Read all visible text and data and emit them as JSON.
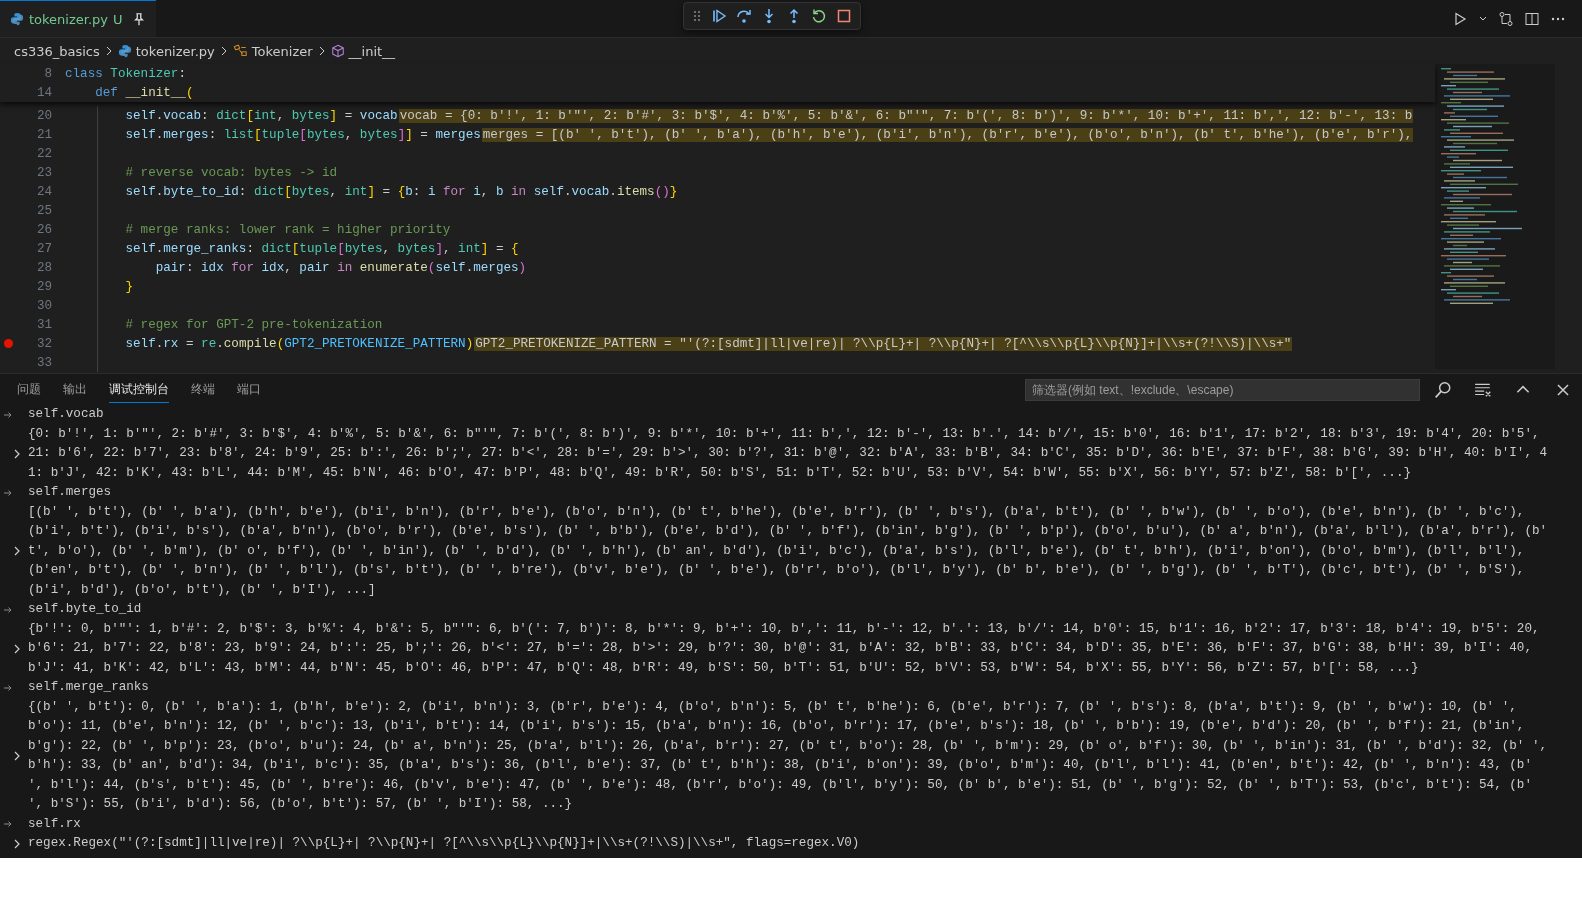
{
  "editor_tab": {
    "label": "tokenizer.py",
    "status": "U",
    "pinned": true
  },
  "breadcrumb": [
    {
      "kind": "folder",
      "label": "cs336_basics"
    },
    {
      "kind": "python",
      "label": "tokenizer.py"
    },
    {
      "kind": "class",
      "label": "Tokenizer"
    },
    {
      "kind": "method",
      "label": "__init__"
    }
  ],
  "sticky_lines": [
    {
      "num": "8",
      "tokens": [
        {
          "kind": "kw",
          "text": "class"
        },
        {
          "kind": "cls",
          "text": " Tokenizer"
        },
        {
          "kind": "op",
          "text": ":"
        }
      ]
    },
    {
      "num": "14",
      "tokens": [
        {
          "kind": "kw",
          "text": "    def"
        },
        {
          "kind": "fn",
          "text": " __init__"
        },
        {
          "kind": "b1",
          "text": "("
        }
      ]
    }
  ],
  "code_lines": [
    {
      "num": "20",
      "breakpoint": false,
      "tokens": [
        {
          "kind": "var",
          "text": "        self"
        },
        {
          "kind": "op",
          "text": "."
        },
        {
          "kind": "var",
          "text": "vocab"
        },
        {
          "kind": "op",
          "text": ": "
        },
        {
          "kind": "cls",
          "text": "dict"
        },
        {
          "kind": "b1",
          "text": "["
        },
        {
          "kind": "cls",
          "text": "int"
        },
        {
          "kind": "op",
          "text": ", "
        },
        {
          "kind": "cls",
          "text": "bytes"
        },
        {
          "kind": "b1",
          "text": "]"
        },
        {
          "kind": "op",
          "text": " = "
        },
        {
          "kind": "var",
          "text": "vocab"
        }
      ],
      "inline_value": "vocab = {0: b'!', 1: b'\"', 2: b'#', 3: b'$', 4: b'%', 5: b'&', 6: b\"'\", 7: b'(', 8: b')', 9: b'*', 10: b'+', 11: b',', 12: b'-', 13: b"
    },
    {
      "num": "21",
      "breakpoint": false,
      "tokens": [
        {
          "kind": "var",
          "text": "        self"
        },
        {
          "kind": "op",
          "text": "."
        },
        {
          "kind": "var",
          "text": "merges"
        },
        {
          "kind": "op",
          "text": ": "
        },
        {
          "kind": "cls",
          "text": "list"
        },
        {
          "kind": "b1",
          "text": "["
        },
        {
          "kind": "cls",
          "text": "tuple"
        },
        {
          "kind": "b2",
          "text": "["
        },
        {
          "kind": "cls",
          "text": "bytes"
        },
        {
          "kind": "op",
          "text": ", "
        },
        {
          "kind": "cls",
          "text": "bytes"
        },
        {
          "kind": "b2",
          "text": "]"
        },
        {
          "kind": "b1",
          "text": "]"
        },
        {
          "kind": "op",
          "text": " = "
        },
        {
          "kind": "var",
          "text": "merges"
        }
      ],
      "inline_value": "merges = [(b' ', b't'), (b' ', b'a'), (b'h', b'e'), (b'i', b'n'), (b'r', b'e'), (b'o', b'n'), (b' t', b'he'), (b'e', b'r'),"
    },
    {
      "num": "22",
      "breakpoint": false
    },
    {
      "num": "23",
      "breakpoint": false,
      "tokens": [
        {
          "kind": "cmt",
          "text": "        # reverse vocab: bytes -> id"
        }
      ]
    },
    {
      "num": "24",
      "breakpoint": false,
      "tokens": [
        {
          "kind": "var",
          "text": "        self"
        },
        {
          "kind": "op",
          "text": "."
        },
        {
          "kind": "var",
          "text": "byte_to_id"
        },
        {
          "kind": "op",
          "text": ": "
        },
        {
          "kind": "cls",
          "text": "dict"
        },
        {
          "kind": "b1",
          "text": "["
        },
        {
          "kind": "cls",
          "text": "bytes"
        },
        {
          "kind": "op",
          "text": ", "
        },
        {
          "kind": "cls",
          "text": "int"
        },
        {
          "kind": "b1",
          "text": "]"
        },
        {
          "kind": "op",
          "text": " = "
        },
        {
          "kind": "b1",
          "text": "{"
        },
        {
          "kind": "var",
          "text": "b"
        },
        {
          "kind": "op",
          "text": ": "
        },
        {
          "kind": "var",
          "text": "i"
        },
        {
          "kind": "ctrl",
          "text": " for "
        },
        {
          "kind": "var",
          "text": "i"
        },
        {
          "kind": "op",
          "text": ", "
        },
        {
          "kind": "var",
          "text": "b"
        },
        {
          "kind": "ctrl",
          "text": " in "
        },
        {
          "kind": "var",
          "text": "self"
        },
        {
          "kind": "op",
          "text": "."
        },
        {
          "kind": "var",
          "text": "vocab"
        },
        {
          "kind": "op",
          "text": "."
        },
        {
          "kind": "fn",
          "text": "items"
        },
        {
          "kind": "b2",
          "text": "()"
        },
        {
          "kind": "b1",
          "text": "}"
        }
      ]
    },
    {
      "num": "25",
      "breakpoint": false
    },
    {
      "num": "26",
      "breakpoint": false,
      "tokens": [
        {
          "kind": "cmt",
          "text": "        # merge ranks: lower rank = higher priority"
        }
      ]
    },
    {
      "num": "27",
      "breakpoint": false,
      "tokens": [
        {
          "kind": "var",
          "text": "        self"
        },
        {
          "kind": "op",
          "text": "."
        },
        {
          "kind": "var",
          "text": "merge_ranks"
        },
        {
          "kind": "op",
          "text": ": "
        },
        {
          "kind": "cls",
          "text": "dict"
        },
        {
          "kind": "b1",
          "text": "["
        },
        {
          "kind": "cls",
          "text": "tuple"
        },
        {
          "kind": "b2",
          "text": "["
        },
        {
          "kind": "cls",
          "text": "bytes"
        },
        {
          "kind": "op",
          "text": ", "
        },
        {
          "kind": "cls",
          "text": "bytes"
        },
        {
          "kind": "b2",
          "text": "]"
        },
        {
          "kind": "op",
          "text": ", "
        },
        {
          "kind": "cls",
          "text": "int"
        },
        {
          "kind": "b1",
          "text": "]"
        },
        {
          "kind": "op",
          "text": " = "
        },
        {
          "kind": "b1",
          "text": "{"
        }
      ]
    },
    {
      "num": "28",
      "breakpoint": false,
      "tokens": [
        {
          "kind": "var",
          "text": "            pair"
        },
        {
          "kind": "op",
          "text": ": "
        },
        {
          "kind": "var",
          "text": "idx"
        },
        {
          "kind": "ctrl",
          "text": " for "
        },
        {
          "kind": "var",
          "text": "idx"
        },
        {
          "kind": "op",
          "text": ", "
        },
        {
          "kind": "var",
          "text": "pair"
        },
        {
          "kind": "ctrl",
          "text": " in "
        },
        {
          "kind": "fn",
          "text": "enumerate"
        },
        {
          "kind": "b2",
          "text": "("
        },
        {
          "kind": "var",
          "text": "self"
        },
        {
          "kind": "op",
          "text": "."
        },
        {
          "kind": "var",
          "text": "merges"
        },
        {
          "kind": "b2",
          "text": ")"
        }
      ]
    },
    {
      "num": "29",
      "breakpoint": false,
      "tokens": [
        {
          "kind": "b1",
          "text": "        }"
        }
      ]
    },
    {
      "num": "30",
      "breakpoint": false
    },
    {
      "num": "31",
      "breakpoint": false,
      "tokens": [
        {
          "kind": "cmt",
          "text": "        # regex for GPT-2 pre-tokenization"
        }
      ]
    },
    {
      "num": "32",
      "breakpoint": true,
      "tokens": [
        {
          "kind": "var",
          "text": "        self"
        },
        {
          "kind": "op",
          "text": "."
        },
        {
          "kind": "var",
          "text": "rx"
        },
        {
          "kind": "op",
          "text": " = "
        },
        {
          "kind": "cls",
          "text": "re"
        },
        {
          "kind": "op",
          "text": "."
        },
        {
          "kind": "fn",
          "text": "compile"
        },
        {
          "kind": "b1",
          "text": "("
        },
        {
          "kind": "const",
          "text": "GPT2_PRETOKENIZE_PATTERN"
        },
        {
          "kind": "b1",
          "text": ")"
        }
      ],
      "inline_value": "GPT2_PRETOKENIZE_PATTERN = \"'(?:[sdmt]|ll|ve|re)| ?\\\\p{L}+| ?\\\\p{N}+| ?[^\\\\s\\\\p{L}\\\\p{N}]+|\\\\s+(?!\\\\S)|\\\\s+\""
    },
    {
      "num": "33",
      "breakpoint": false
    }
  ],
  "panel": {
    "tabs": [
      {
        "label": "问题",
        "selected": false
      },
      {
        "label": "输出",
        "selected": false
      },
      {
        "label": "调试控制台",
        "selected": true
      },
      {
        "label": "终端",
        "selected": false
      },
      {
        "label": "端口",
        "selected": false
      }
    ],
    "filter": {
      "placeholder": "筛选器(例如 text、!exclude、\\escape)"
    },
    "console": [
      {
        "input": "self.vocab",
        "output": [
          "{0: b'!', 1: b'\"', 2: b'#', 3: b'$', 4: b'%', 5: b'&', 6: b\"'\", 7: b'(', 8: b')', 9: b'*', 10: b'+', 11: b',', 12: b'-', 13: b'.', 14: b'/', 15: b'0', 16: b'1', 17: b'2', 18: b'3', 19: b'4', 20: b'5',",
          "21: b'6', 22: b'7', 23: b'8', 24: b'9', 25: b':', 26: b';', 27: b'<', 28: b'=', 29: b'>', 30: b'?', 31: b'@', 32: b'A', 33: b'B', 34: b'C', 35: b'D', 36: b'E', 37: b'F', 38: b'G', 39: b'H', 40: b'I', 4",
          "1: b'J', 42: b'K', 43: b'L', 44: b'M', 45: b'N', 46: b'O', 47: b'P', 48: b'Q', 49: b'R', 50: b'S', 51: b'T', 52: b'U', 53: b'V', 54: b'W', 55: b'X', 56: b'Y', 57: b'Z', 58: b'[', ...}"
        ]
      },
      {
        "input": "self.merges",
        "output": [
          "[(b' ', b't'), (b' ', b'a'), (b'h', b'e'), (b'i', b'n'), (b'r', b'e'), (b'o', b'n'), (b' t', b'he'), (b'e', b'r'), (b' ', b's'), (b'a', b't'), (b' ', b'w'), (b' ', b'o'), (b'e', b'n'), (b' ', b'c'),",
          "(b'i', b't'), (b'i', b's'), (b'a', b'n'), (b'o', b'r'), (b'e', b's'), (b' ', b'b'), (b'e', b'd'), (b' ', b'f'), (b'in', b'g'), (b' ', b'p'), (b'o', b'u'), (b' a', b'n'), (b'a', b'l'), (b'a', b'r'), (b'",
          "t', b'o'), (b' ', b'm'), (b' o', b'f'), (b' ', b'in'), (b' ', b'd'), (b' ', b'h'), (b' an', b'd'), (b'i', b'c'), (b'a', b's'), (b'l', b'e'), (b' t', b'h'), (b'i', b'on'), (b'o', b'm'), (b'l', b'l'),",
          "(b'en', b't'), (b' ', b'n'), (b' ', b'l'), (b's', b't'), (b' ', b're'), (b'v', b'e'), (b' ', b'e'), (b'r', b'o'), (b'l', b'y'), (b' b', b'e'), (b' ', b'g'), (b' ', b'T'), (b'c', b't'), (b' ', b'S'),",
          "(b'i', b'd'), (b'o', b't'), (b' ', b'I'), ...]"
        ]
      },
      {
        "input": "self.byte_to_id",
        "output": [
          "{b'!': 0, b'\"': 1, b'#': 2, b'$': 3, b'%': 4, b'&': 5, b\"'\": 6, b'(': 7, b')': 8, b'*': 9, b'+': 10, b',': 11, b'-': 12, b'.': 13, b'/': 14, b'0': 15, b'1': 16, b'2': 17, b'3': 18, b'4': 19, b'5': 20,",
          "b'6': 21, b'7': 22, b'8': 23, b'9': 24, b':': 25, b';': 26, b'<': 27, b'=': 28, b'>': 29, b'?': 30, b'@': 31, b'A': 32, b'B': 33, b'C': 34, b'D': 35, b'E': 36, b'F': 37, b'G': 38, b'H': 39, b'I': 40,",
          "b'J': 41, b'K': 42, b'L': 43, b'M': 44, b'N': 45, b'O': 46, b'P': 47, b'Q': 48, b'R': 49, b'S': 50, b'T': 51, b'U': 52, b'V': 53, b'W': 54, b'X': 55, b'Y': 56, b'Z': 57, b'[': 58, ...}"
        ]
      },
      {
        "input": "self.merge_ranks",
        "output": [
          "{(b' ', b't'): 0, (b' ', b'a'): 1, (b'h', b'e'): 2, (b'i', b'n'): 3, (b'r', b'e'): 4, (b'o', b'n'): 5, (b' t', b'he'): 6, (b'e', b'r'): 7, (b' ', b's'): 8, (b'a', b't'): 9, (b' ', b'w'): 10, (b' ',",
          "b'o'): 11, (b'e', b'n'): 12, (b' ', b'c'): 13, (b'i', b't'): 14, (b'i', b's'): 15, (b'a', b'n'): 16, (b'o', b'r'): 17, (b'e', b's'): 18, (b' ', b'b'): 19, (b'e', b'd'): 20, (b' ', b'f'): 21, (b'in',",
          "b'g'): 22, (b' ', b'p'): 23, (b'o', b'u'): 24, (b' a', b'n'): 25, (b'a', b'l'): 26, (b'a', b'r'): 27, (b' t', b'o'): 28, (b' ', b'm'): 29, (b' o', b'f'): 30, (b' ', b'in'): 31, (b' ', b'd'): 32, (b' ',",
          "b'h'): 33, (b' an', b'd'): 34, (b'i', b'c'): 35, (b'a', b's'): 36, (b'l', b'e'): 37, (b' t', b'h'): 38, (b'i', b'on'): 39, (b'o', b'm'): 40, (b'l', b'l'): 41, (b'en', b't'): 42, (b' ', b'n'): 43, (b'",
          "', b'l'): 44, (b's', b't'): 45, (b' ', b're'): 46, (b'v', b'e'): 47, (b' ', b'e'): 48, (b'r', b'o'): 49, (b'l', b'y'): 50, (b' b', b'e'): 51, (b' ', b'g'): 52, (b' ', b'T'): 53, (b'c', b't'): 54, (b'",
          "', b'S'): 55, (b'i', b'd'): 56, (b'o', b't'): 57, (b' ', b'I'): 58, ...}"
        ]
      },
      {
        "input": "self.rx",
        "output": [
          "regex.Regex(\"'(?:[sdmt]|ll|ve|re)| ?\\\\p{L}+| ?\\\\p{N}+| ?[^\\\\s\\\\p{L}\\\\p{N}]+|\\\\s+(?!\\\\S)|\\\\s+\", flags=regex.V0)"
        ]
      }
    ]
  }
}
